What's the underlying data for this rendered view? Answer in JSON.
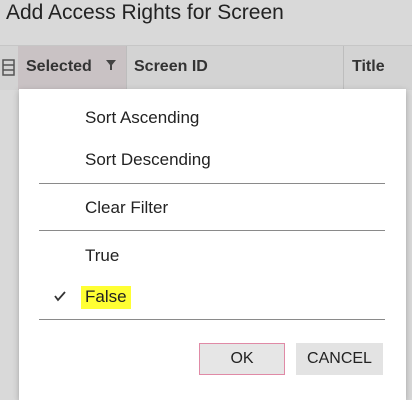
{
  "dialog": {
    "title": "Add Access Rights for Screen"
  },
  "grid": {
    "columns": {
      "selected": "Selected",
      "screen_id": "Screen ID",
      "title": "Title"
    }
  },
  "filter_menu": {
    "sort_ascending": "Sort Ascending",
    "sort_descending": "Sort Descending",
    "clear_filter": "Clear Filter",
    "option_true": "True",
    "option_false": "False",
    "selected_option": "False",
    "highlight_color": "#ffff33"
  },
  "buttons": {
    "ok": "OK",
    "cancel": "CANCEL"
  },
  "icons": [
    "grid-settings-icon",
    "filter-funnel-icon",
    "checkmark-icon"
  ]
}
